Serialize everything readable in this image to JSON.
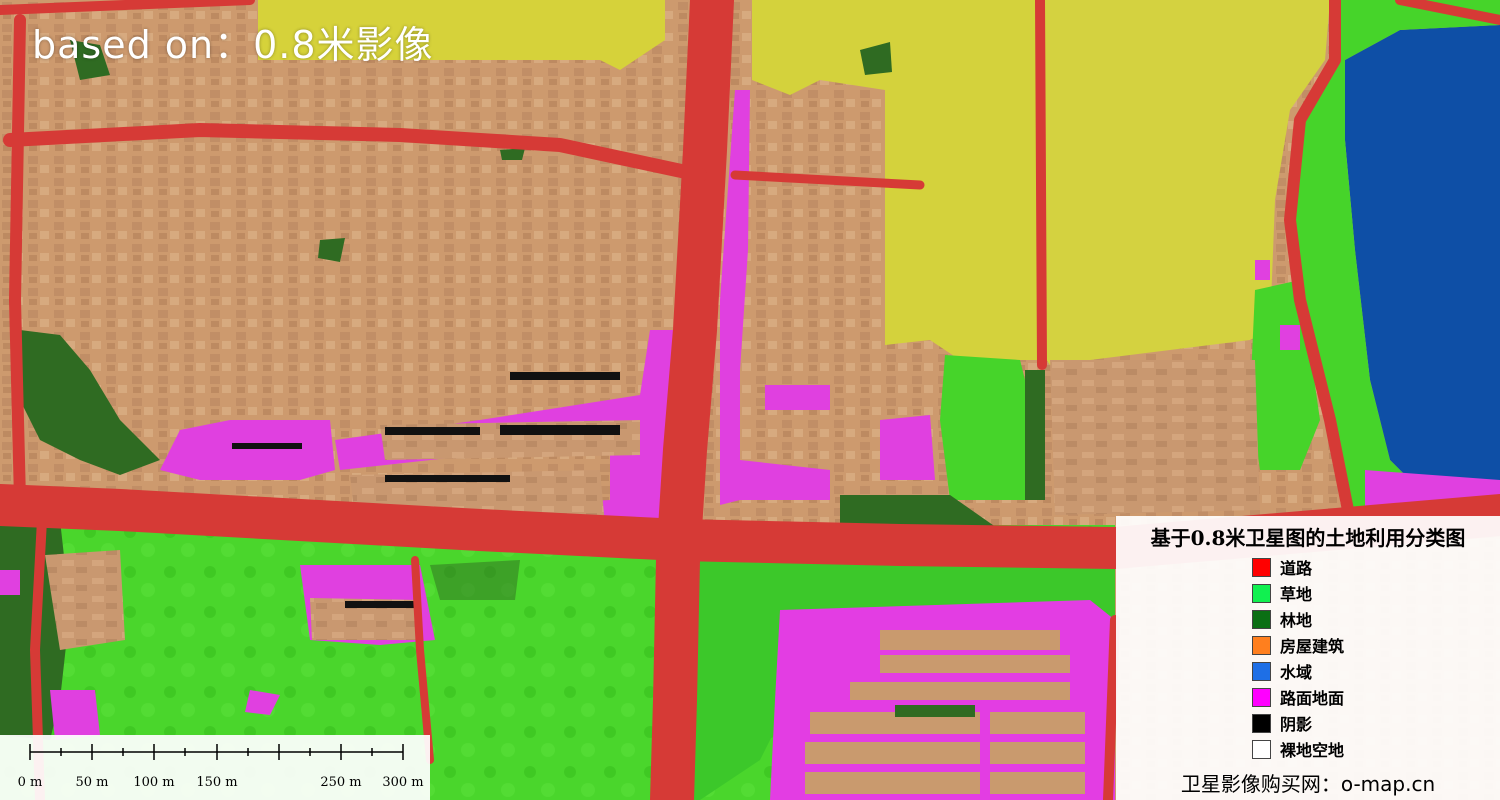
{
  "watermark": "based on：0.8米影像",
  "legend": {
    "title": "基于0.8米卫星图的土地利用分类图",
    "items": [
      {
        "label": "道路",
        "color": "#ff0000"
      },
      {
        "label": "草地",
        "color": "#11f050"
      },
      {
        "label": "林地",
        "color": "#0b6f14"
      },
      {
        "label": "房屋建筑",
        "color": "#ff7f1e"
      },
      {
        "label": "水域",
        "color": "#1e6fe6"
      },
      {
        "label": "路面地面",
        "color": "#ff00ff"
      },
      {
        "label": "阴影",
        "color": "#000000"
      },
      {
        "label": "裸地空地",
        "color": "#ffffff"
      }
    ],
    "footer": "卫星影像购买网：o-map.cn"
  },
  "scale_bar": {
    "labels": [
      "0 m",
      "50 m",
      "100 m",
      "150 m",
      "250 m",
      "300 m"
    ]
  },
  "colors": {
    "road": "#d63a36",
    "building": "#cf9a70",
    "grass": "#46d42a",
    "forest": "#2f6b22",
    "yellow_field": "#d2d038",
    "pavement": "#e040e0",
    "water": "#0e4fa6",
    "shadow": "#111111"
  }
}
